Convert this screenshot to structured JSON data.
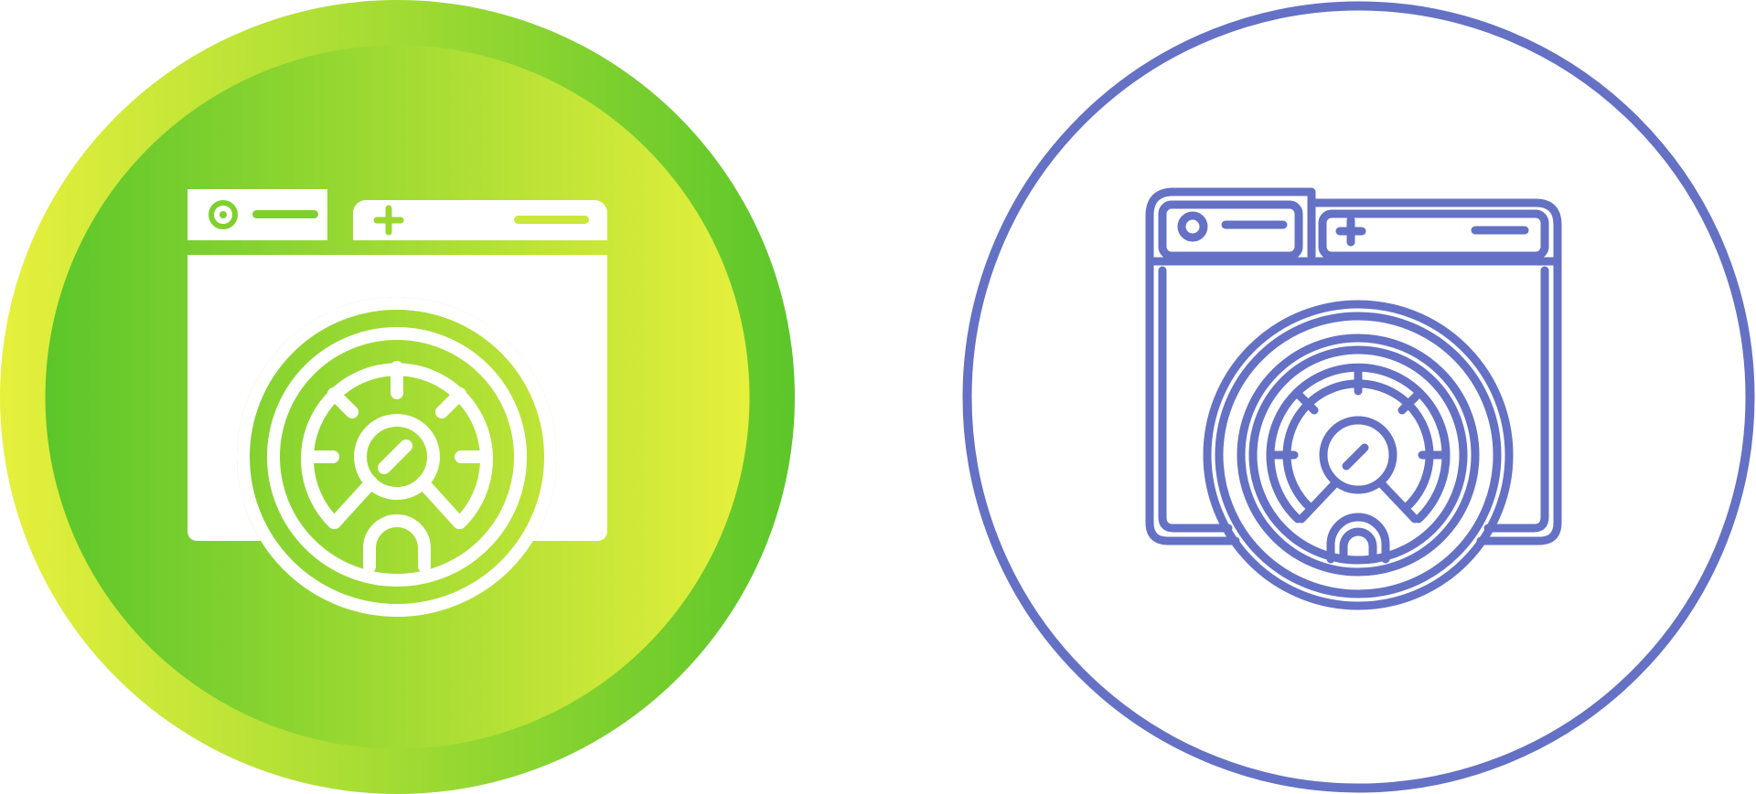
{
  "icons": [
    {
      "name": "browser-speedometer-icon",
      "variant": "glyph",
      "colors": {
        "outer_gradient_start": "#e6f03c",
        "outer_gradient_end": "#5cc62a",
        "inner_gradient_start": "#5cc62a",
        "inner_gradient_end": "#e6f03c",
        "glyph": "#ffffff"
      }
    },
    {
      "name": "browser-speedometer-icon",
      "variant": "line",
      "colors": {
        "background": "#ffffff",
        "stroke": "#6471c4"
      }
    }
  ]
}
